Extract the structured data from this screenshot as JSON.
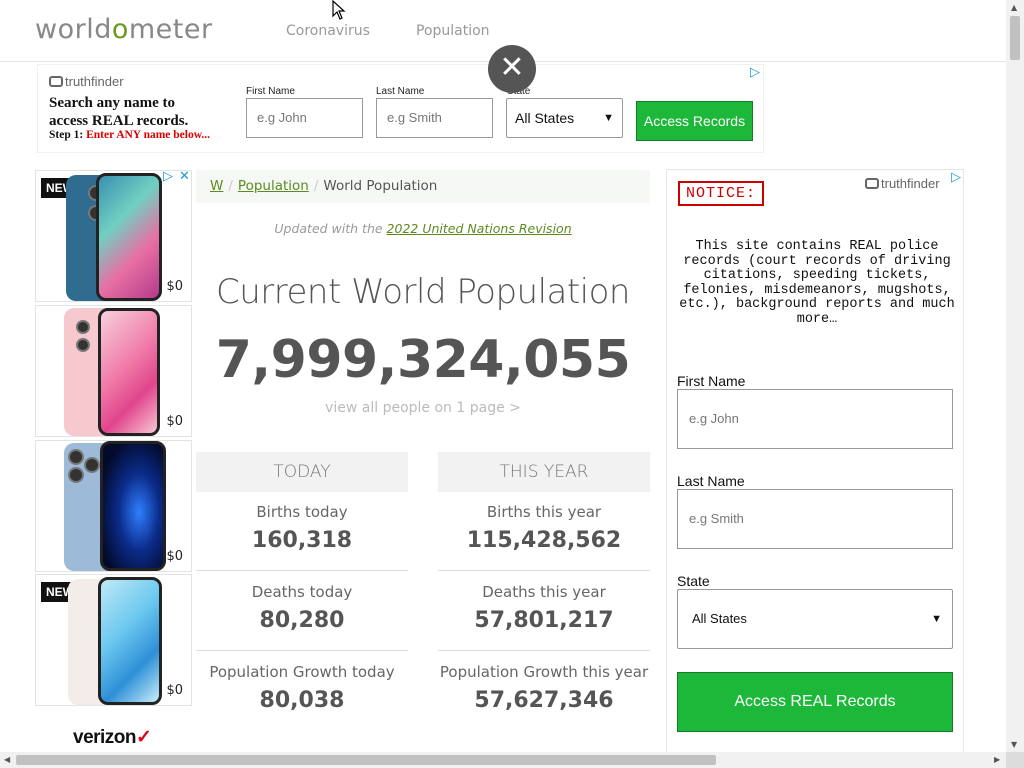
{
  "header": {
    "logo_prefix": "world",
    "logo_o": "o",
    "logo_suffix": "meter",
    "nav": [
      "Coronavirus",
      "Population"
    ]
  },
  "overlay": {
    "close_symbol": "✕"
  },
  "top_ad": {
    "brand": "truthfinder",
    "headline_line1": "Search any name to",
    "headline_line2": "access REAL records.",
    "step_label": "Step 1:",
    "step_text": "Enter ANY name below...",
    "first_name_label": "First Name",
    "first_name_placeholder": "e.g John",
    "last_name_label": "Last Name",
    "last_name_placeholder": "e.g Smith",
    "state_label": "State",
    "state_value": "All States",
    "button": "Access Records"
  },
  "phone_ad": {
    "items": [
      {
        "badge": "NEW",
        "price": "$0"
      },
      {
        "badge": "",
        "price": "$0"
      },
      {
        "badge": "",
        "price": "$0"
      },
      {
        "badge": "NEW",
        "price": "$0"
      }
    ],
    "brand": "verizon",
    "brand_tick": "✓"
  },
  "breadcrumb": {
    "home": "W",
    "section": "Population",
    "current": "World Population"
  },
  "updated": {
    "prefix": "Updated with the ",
    "link": "2022 United Nations Revision"
  },
  "main": {
    "title": "Current World Population",
    "population": "7,999,324,055",
    "view_all": "view all people on 1 page >"
  },
  "stats": {
    "today": {
      "header": "TODAY",
      "rows": [
        {
          "label": "Births today",
          "value": "160,318"
        },
        {
          "label": "Deaths today",
          "value": "80,280"
        },
        {
          "label": "Population Growth today",
          "value": "80,038"
        }
      ]
    },
    "year": {
      "header": "THIS YEAR",
      "rows": [
        {
          "label": "Births this year",
          "value": "115,428,562"
        },
        {
          "label": "Deaths this year",
          "value": "57,801,217"
        },
        {
          "label": "Population Growth this year",
          "value": "57,627,346"
        }
      ]
    }
  },
  "right_ad": {
    "brand": "truthfinder",
    "notice": "NOTICE:",
    "notice_text": "This site contains REAL police records (court records of driving citations, speeding tickets, felonies, misdemeanors, mugshots, etc.), background reports and much more…",
    "first_name_label": "First Name",
    "first_name_placeholder": "e.g John",
    "last_name_label": "Last Name",
    "last_name_placeholder": "e.g Smith",
    "state_label": "State",
    "state_value": "All States",
    "button": "Access REAL Records"
  },
  "colors": {
    "accent_green": "#5d8a1f",
    "cta_green": "#1db83a",
    "notice_red": "#cc0000",
    "adchoices_blue": "#1a9bd6"
  }
}
